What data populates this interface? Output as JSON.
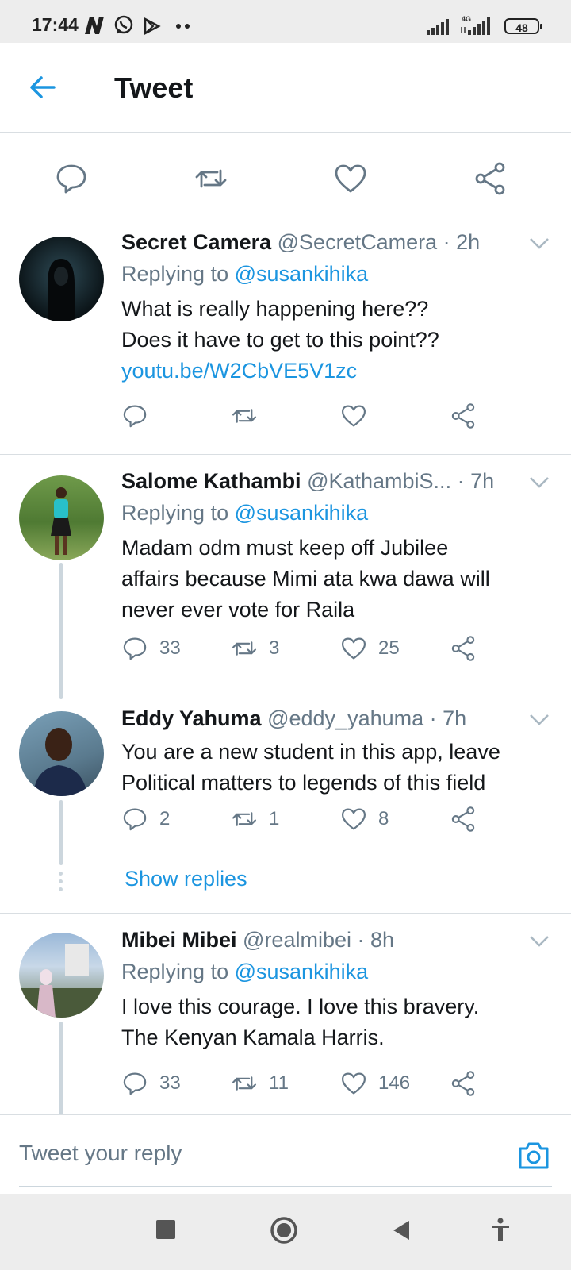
{
  "status_bar": {
    "time": "17:44",
    "battery": "48",
    "icons": [
      "netflix-icon",
      "whatsapp-icon",
      "play-store-icon",
      "more-dots-icon",
      "signal-icon",
      "4g-signal-icon",
      "battery-icon"
    ]
  },
  "header": {
    "title": "Tweet",
    "back_icon": "back-arrow-icon"
  },
  "colors": {
    "accent": "#1b95e0",
    "muted": "#657786",
    "divider": "#d9dee2",
    "text": "#14171a"
  },
  "replies": [
    {
      "name": "Secret Camera",
      "handle": "@SecretCamera",
      "time": "2h",
      "replying_prefix": "Replying to",
      "replying_to": "@susankihika",
      "lines": [
        "What is really happening here??",
        "Does it have to get to this point??"
      ],
      "link": "youtu.be/W2CbVE5V1zc",
      "counts": {
        "reply": "",
        "retweet": "",
        "like": ""
      }
    },
    {
      "name": "Salome Kathambi",
      "handle": "@KathambiS...",
      "time": "7h",
      "replying_prefix": "Replying to",
      "replying_to": "@susankihika",
      "lines": [
        "Madam odm must keep off Jubilee",
        "affairs because Mimi ata kwa dawa will",
        "never ever vote for Raila"
      ],
      "counts": {
        "reply": "33",
        "retweet": "3",
        "like": "25"
      }
    },
    {
      "name": "Eddy Yahuma",
      "handle": "@eddy_yahuma",
      "time": "7h",
      "lines": [
        "You are a new student in this app, leave",
        "Political matters to legends of this field"
      ],
      "counts": {
        "reply": "2",
        "retweet": "1",
        "like": "8"
      },
      "show_replies": "Show replies"
    },
    {
      "name": "Mibei Mibei",
      "handle": "@realmibei",
      "time": "8h",
      "replying_prefix": "Replying to",
      "replying_to": "@susankihika",
      "lines": [
        "I love this courage. I love this bravery.",
        "The Kenyan Kamala Harris."
      ],
      "counts": {
        "reply": "33",
        "retweet": "11",
        "like": "146"
      }
    }
  ],
  "compose": {
    "placeholder": "Tweet your reply",
    "camera_icon": "camera-icon"
  },
  "nav": [
    "recents-square-icon",
    "home-circle-icon",
    "back-triangle-icon",
    "accessibility-icon"
  ]
}
